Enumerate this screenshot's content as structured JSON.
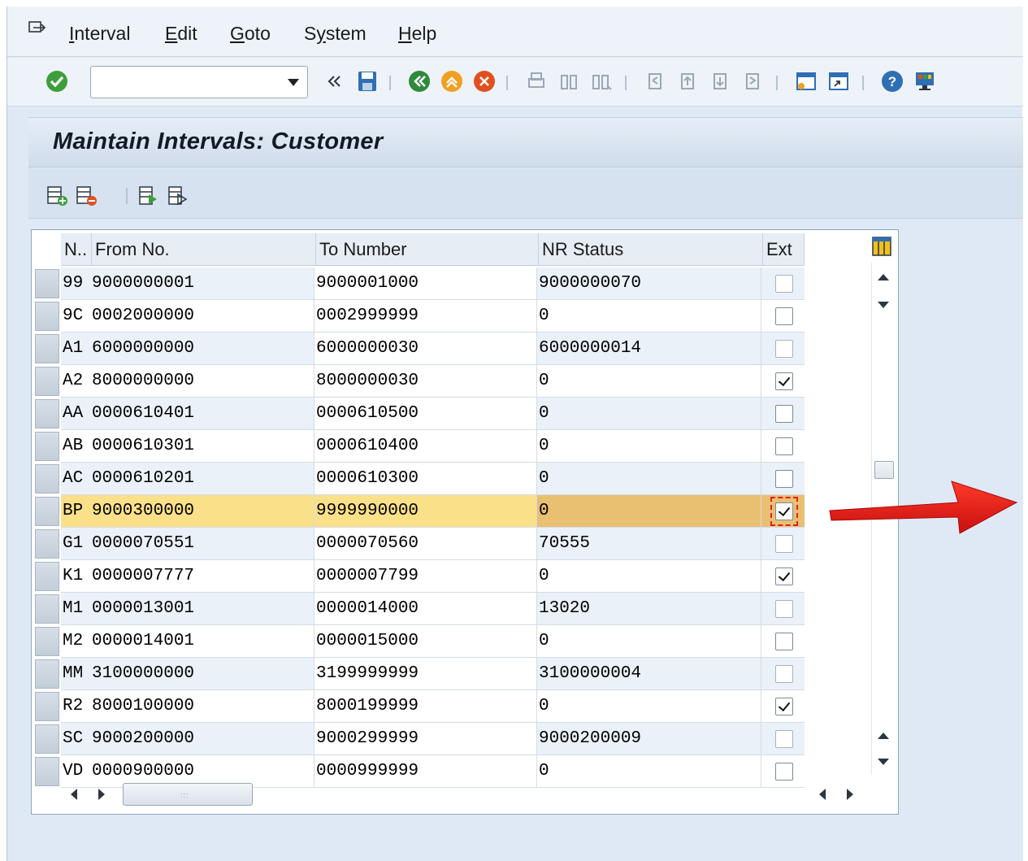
{
  "menubar": {
    "items": [
      {
        "label": "Interval",
        "underline": "I"
      },
      {
        "label": "Edit",
        "underline": "E"
      },
      {
        "label": "Goto",
        "underline": "G"
      },
      {
        "label": "System",
        "underline": "y"
      },
      {
        "label": "Help",
        "underline": "H"
      }
    ]
  },
  "toolbar": {
    "command_field": {
      "value": "",
      "placeholder": ""
    },
    "icons": [
      "enter-icon",
      "back-icon",
      "save-icon",
      "back-nav-icon",
      "exit-icon",
      "cancel-icon",
      "print-icon",
      "find-icon",
      "find-next-icon",
      "first-page-icon",
      "previous-page-icon",
      "next-page-icon",
      "last-page-icon",
      "create-session-icon",
      "shortcut-icon",
      "help-icon",
      "layout-icon"
    ]
  },
  "screen": {
    "title": "Maintain Intervals: Customer"
  },
  "table": {
    "columns": [
      "N..",
      "From No.",
      "To Number",
      "NR Status",
      "Ext"
    ],
    "rows": [
      {
        "n": "99",
        "from": "9000000001",
        "to": "9000001000",
        "status": "9000000070",
        "ext": false,
        "dim": true
      },
      {
        "n": "9C",
        "from": "0002000000",
        "to": "0002999999",
        "status": "0",
        "ext": false,
        "dim": false
      },
      {
        "n": "A1",
        "from": "6000000000",
        "to": "6000000030",
        "status": "6000000014",
        "ext": false,
        "dim": true
      },
      {
        "n": "A2",
        "from": "8000000000",
        "to": "8000000030",
        "status": "0",
        "ext": true,
        "dim": false
      },
      {
        "n": "AA",
        "from": "0000610401",
        "to": "0000610500",
        "status": "0",
        "ext": false,
        "dim": false
      },
      {
        "n": "AB",
        "from": "0000610301",
        "to": "0000610400",
        "status": "0",
        "ext": false,
        "dim": false
      },
      {
        "n": "AC",
        "from": "0000610201",
        "to": "0000610300",
        "status": "0",
        "ext": false,
        "dim": false
      },
      {
        "n": "BP",
        "from": "9000300000",
        "to": "9999990000",
        "status": "0",
        "ext": true,
        "dim": false,
        "selected": true
      },
      {
        "n": "G1",
        "from": "0000070551",
        "to": "0000070560",
        "status": "70555",
        "ext": false,
        "dim": true
      },
      {
        "n": "K1",
        "from": "0000007777",
        "to": "0000007799",
        "status": "0",
        "ext": true,
        "dim": false
      },
      {
        "n": "M1",
        "from": "0000013001",
        "to": "0000014000",
        "status": "13020",
        "ext": false,
        "dim": true
      },
      {
        "n": "M2",
        "from": "0000014001",
        "to": "0000015000",
        "status": "0",
        "ext": false,
        "dim": false
      },
      {
        "n": "MM",
        "from": "3100000000",
        "to": "3199999999",
        "status": "3100000004",
        "ext": false,
        "dim": true
      },
      {
        "n": "R2",
        "from": "8000100000",
        "to": "8000199999",
        "status": "0",
        "ext": true,
        "dim": false
      },
      {
        "n": "SC",
        "from": "9000200000",
        "to": "9000299999",
        "status": "9000200009",
        "ext": false,
        "dim": true
      },
      {
        "n": "VD",
        "from": "0000900000",
        "to": "0000999999",
        "status": "0",
        "ext": false,
        "dim": false
      }
    ]
  },
  "colors": {
    "selected_row": "#fbe08a",
    "annotation_arrow": "#e11a1a",
    "enter_green": "#3e9e3a"
  }
}
